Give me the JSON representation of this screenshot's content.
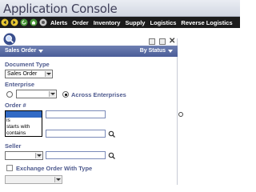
{
  "app": {
    "title": "Application Console"
  },
  "menu": {
    "nav_icons": [
      "back-icon",
      "forward-icon",
      "refresh-icon",
      "home-icon",
      "stop-icon"
    ],
    "items": [
      "Alerts",
      "Order",
      "Inventory",
      "Supply",
      "Logistics",
      "Reverse Logistics"
    ]
  },
  "panel": {
    "title": "Sales Order",
    "view": "By Status",
    "fields": {
      "document_type_label": "Document Type",
      "document_type_value": "Sales Order",
      "enterprise_label": "Enterprise",
      "enterprise_value": "",
      "across_enterprises_label": "Across Enterprises",
      "order_no_label": "Order #",
      "order_no_options": [
        "",
        "is",
        "starts with",
        "contains"
      ],
      "order_no_selected": "",
      "seller_label": "Seller",
      "exchange_label": "Exchange Order With Type"
    }
  },
  "colors": {
    "menu_bg": "#1c1c1c",
    "panel_header": "#5366a2",
    "label": "#4e5a8e"
  }
}
